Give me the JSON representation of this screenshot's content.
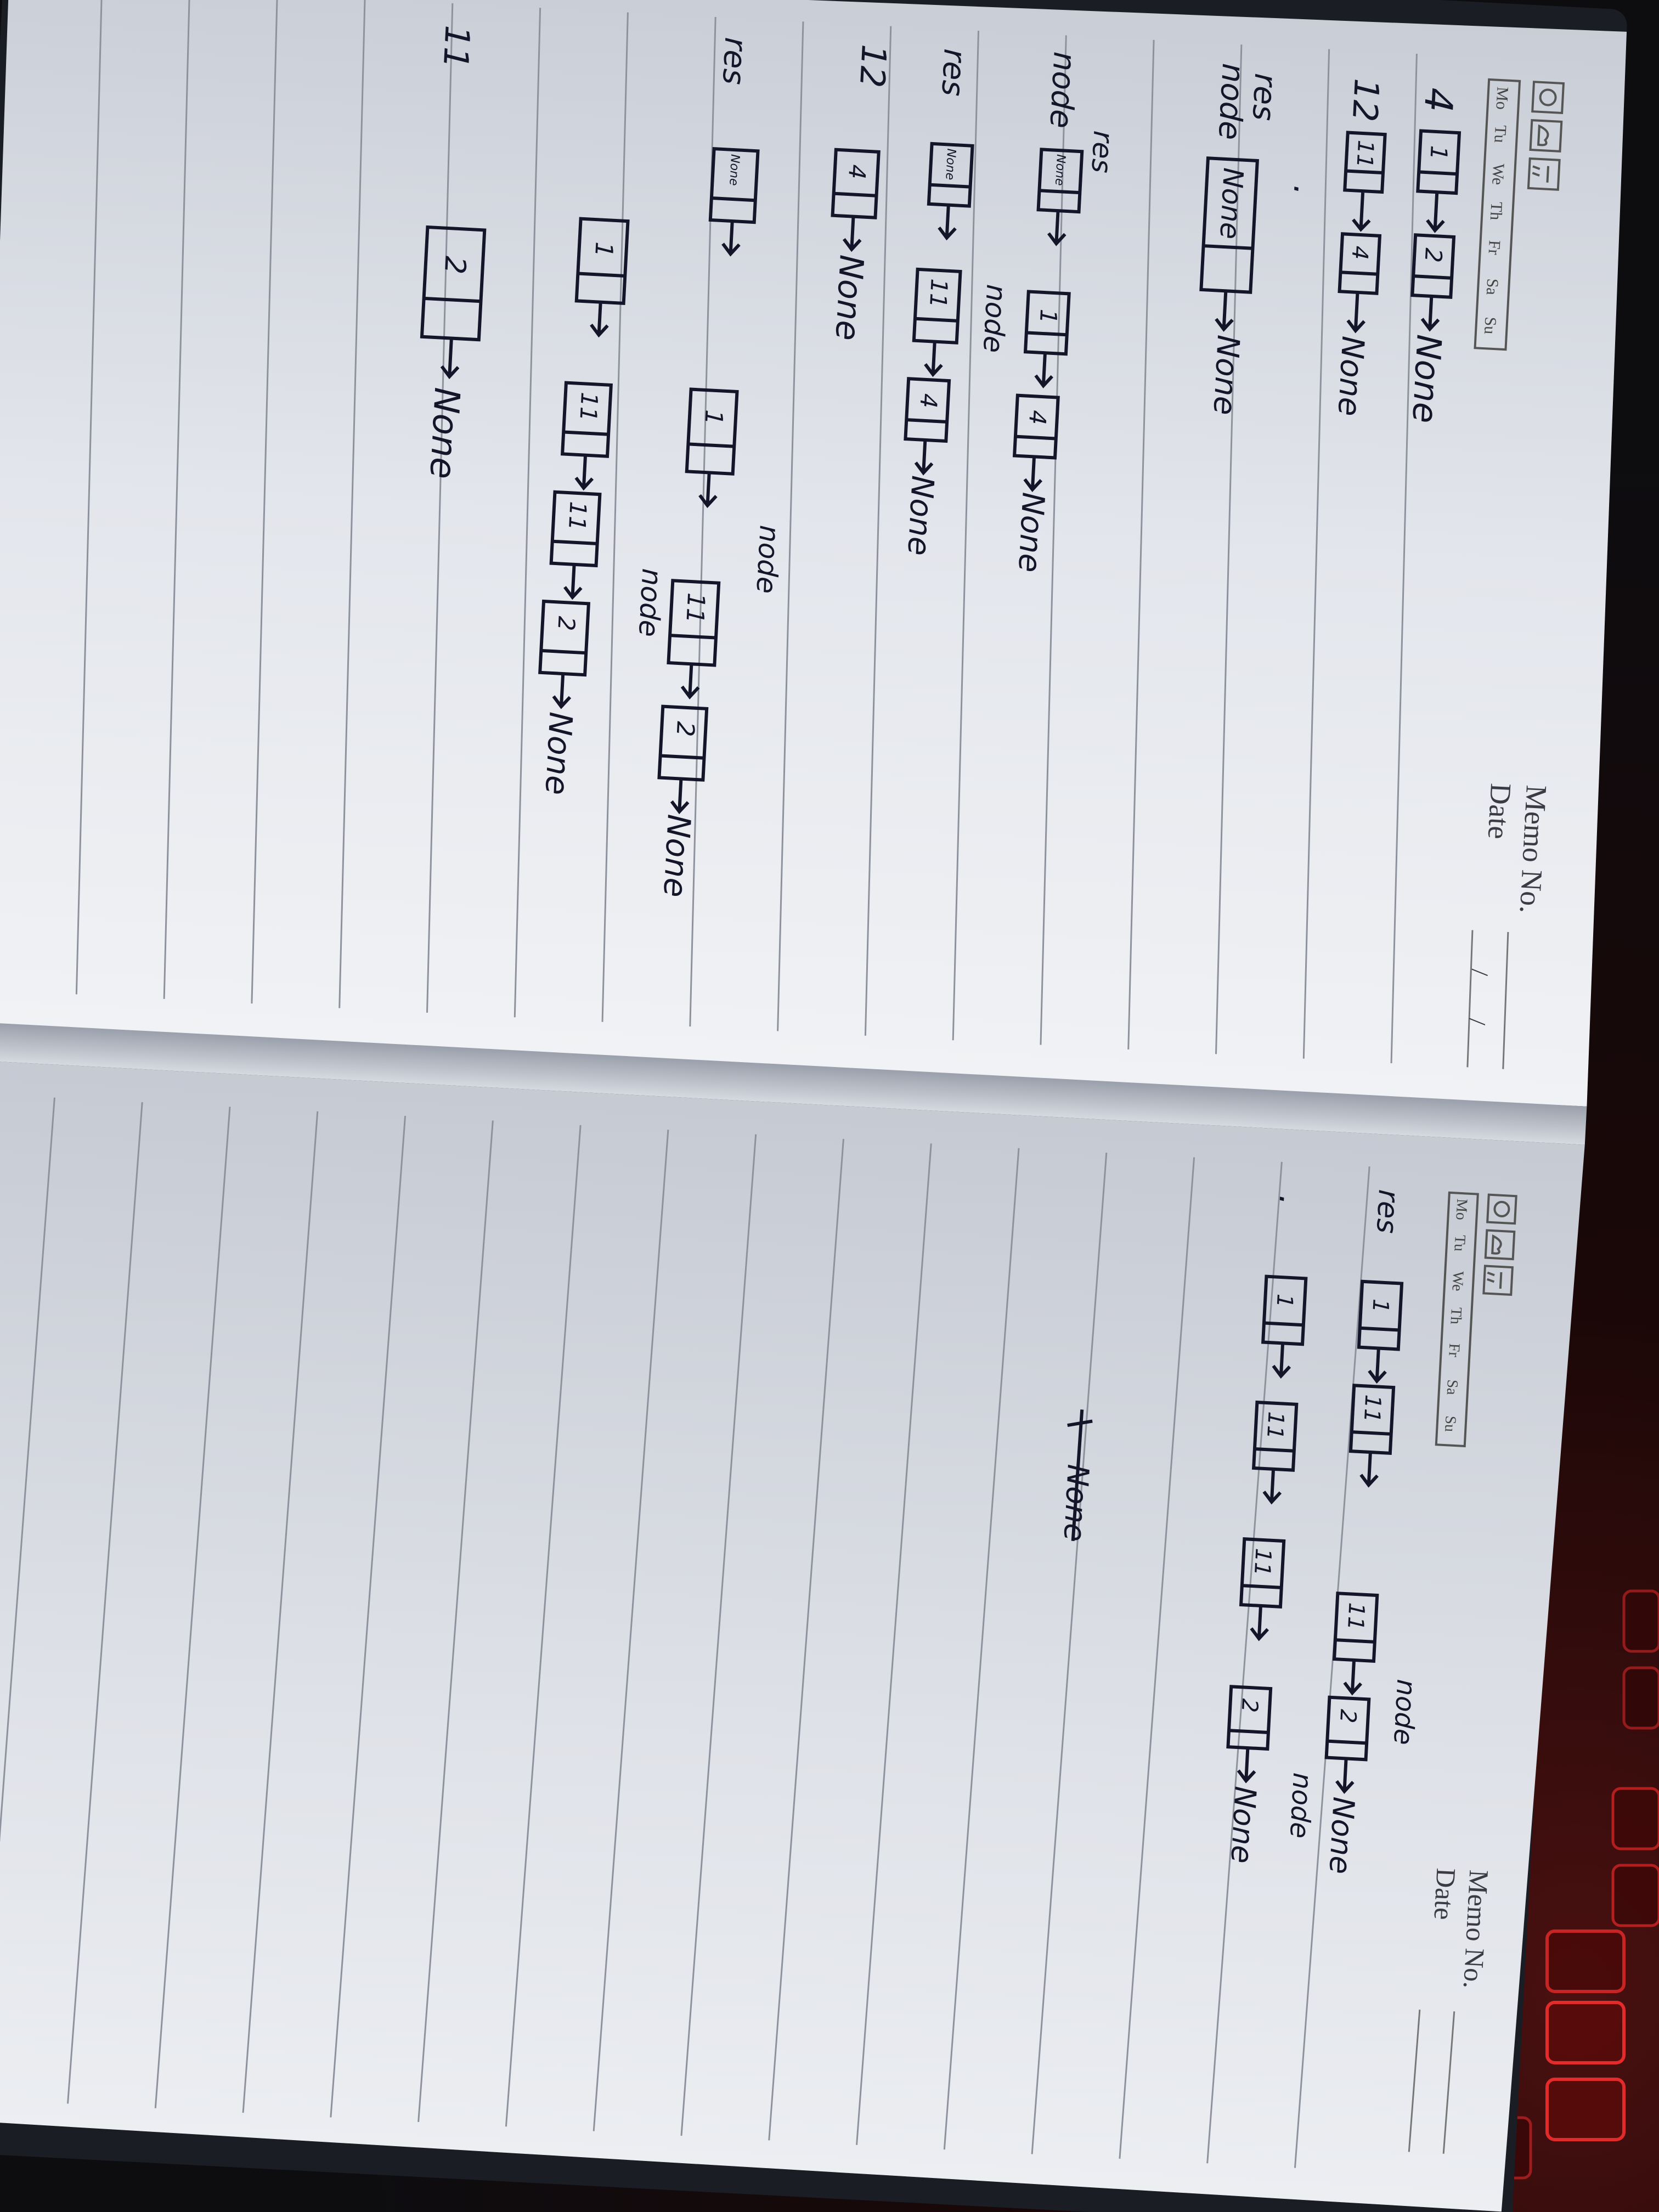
{
  "left_page": {
    "header": {
      "memo_label": "Memo No.",
      "date_label": "Date",
      "slash": "/",
      "weekdays": [
        "Mo",
        "Tu",
        "We",
        "Th",
        "Fr",
        "Sa",
        "Su"
      ]
    },
    "notes": {
      "list_1_prefix": "4",
      "list_1_values": [
        "1",
        "2"
      ],
      "list_2_prefix": "12",
      "list_2_values": [
        "11",
        "4"
      ],
      "terminal": "None",
      "label_res": "res",
      "label_node": "node",
      "label_12": "12",
      "label_11": "11",
      "init_box": "None",
      "init_box_2": ".",
      "row3_values": [
        "None",
        "1",
        "4"
      ],
      "row4_values": [
        "None",
        "11",
        "4"
      ],
      "row5_values": [
        "4"
      ],
      "row6_values": [
        "None",
        "1",
        "11",
        "2"
      ],
      "row7_values": [
        "1",
        "11",
        "11",
        "2"
      ],
      "row8_values": [
        "2"
      ]
    }
  },
  "right_page": {
    "header": {
      "memo_label": "Memo No.",
      "date_label": "Date",
      "weekdays": [
        "Mo",
        "Tu",
        "We",
        "Th",
        "Fr",
        "Sa",
        "Su"
      ]
    },
    "notes": {
      "label_res": "res",
      "label_node": "node",
      "terminal": "None",
      "row1_values": [
        "1",
        "11",
        "11",
        "2"
      ],
      "row2_values": [
        "1",
        "11",
        "11",
        "2"
      ],
      "dot": ".",
      "struck_terminal": "None"
    }
  }
}
